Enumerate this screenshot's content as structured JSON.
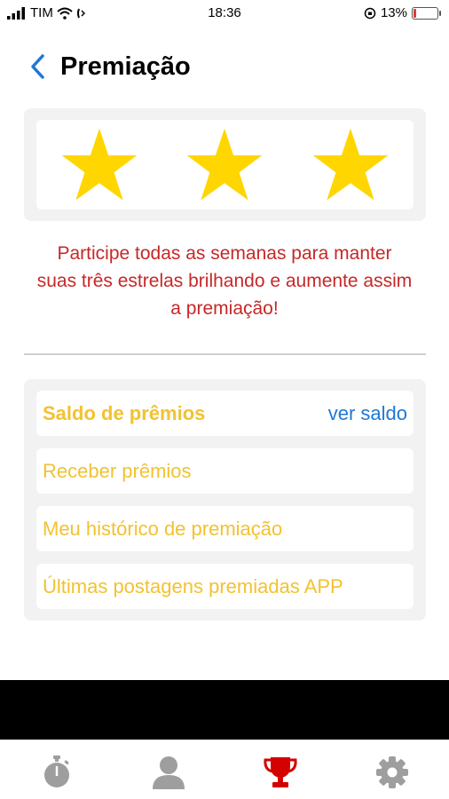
{
  "status_bar": {
    "carrier": "TIM",
    "time": "18:36",
    "battery_percent": "13%",
    "battery_level": 0.13
  },
  "header": {
    "title": "Premiação",
    "back_icon": "chevron-left-icon",
    "accent_color": "#1e78d6"
  },
  "stars": {
    "count": 3,
    "filled": 3,
    "color": "#ffd600"
  },
  "message": {
    "text": "Participe todas as semanas para manter suas três estrelas brilhando e aumente assim a premiação!",
    "color": "#c62828"
  },
  "menu": {
    "items": [
      {
        "label": "Saldo de prêmios",
        "link": "ver saldo"
      },
      {
        "label": "Receber prêmios"
      },
      {
        "label": "Meu histórico de premiação"
      },
      {
        "label": "Últimas postagens premiadas APP"
      }
    ],
    "label_color": "#f2c230"
  },
  "tab_bar": {
    "tabs": [
      {
        "icon": "stopwatch-icon",
        "active": false
      },
      {
        "icon": "user-icon",
        "active": false
      },
      {
        "icon": "trophy-icon",
        "active": true
      },
      {
        "icon": "gear-icon",
        "active": false
      }
    ],
    "active_color": "#d50000",
    "inactive_color": "#9e9e9e"
  }
}
